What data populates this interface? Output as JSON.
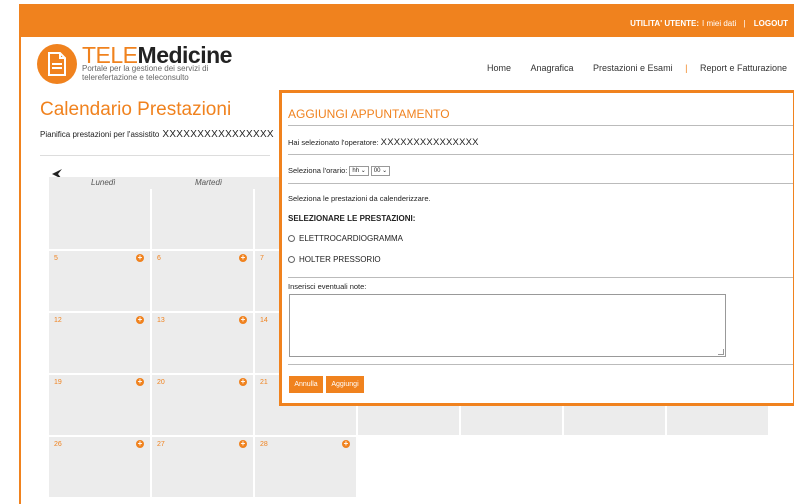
{
  "topbar": {
    "utility_label": "UTILITA' UTENTE:",
    "my_data_link": "I miei dati",
    "separator": "|",
    "logout_link": "LOGOUT"
  },
  "logo": {
    "title_part1": "TELE",
    "title_part2": "Medicine",
    "subtitle": "Portale per la gestione dei servizi di telerefertazione e teleconsulto"
  },
  "nav": {
    "items": [
      "Home",
      "Anagrafica",
      "Prestazioni e Esami",
      "Report e Fatturazione"
    ],
    "separator": "|"
  },
  "page": {
    "title": "Calendario Prestazioni",
    "subtitle_label": "Pianifica prestazioni per l'assistito",
    "patient_name": "XXXXXXXXXXXXXXXX"
  },
  "calendar": {
    "day_names": [
      "Lunedì",
      "Martedì"
    ],
    "rows": [
      [
        "",
        "",
        "",
        "",
        "",
        "",
        ""
      ],
      [
        "5",
        "6",
        "7",
        "",
        "",
        "",
        ""
      ],
      [
        "12",
        "13",
        "14",
        "",
        "",
        "",
        ""
      ],
      [
        "19",
        "20",
        "21",
        "",
        "",
        "",
        ""
      ],
      [
        "26",
        "27",
        "28",
        "",
        "",
        "",
        ""
      ]
    ],
    "add_icon": "plus-circle-icon",
    "back_icon": "arrow-left-icon"
  },
  "modal": {
    "title": "AGGIUNGI APPUNTAMENTO",
    "operator_label": "Hai selezionato l'operatore:",
    "operator_name": "XXXXXXXXXXXXXXX",
    "time_label": "Seleziona l'orario:",
    "hour_value": "hh",
    "minute_value": "00",
    "instructions": "Seleziona le prestazioni da calenderizzare.",
    "services_heading": "SELEZIONARE LE PRESTAZIONI:",
    "services": [
      "ELETTROCARDIOGRAMMA",
      "HOLTER PRESSORIO"
    ],
    "notes_label": "Inserisci eventuali note:",
    "cancel_button": "Annulla",
    "add_button": "Aggiungi"
  },
  "colors": {
    "accent": "#f0821e",
    "cell_bg": "#ececec"
  }
}
